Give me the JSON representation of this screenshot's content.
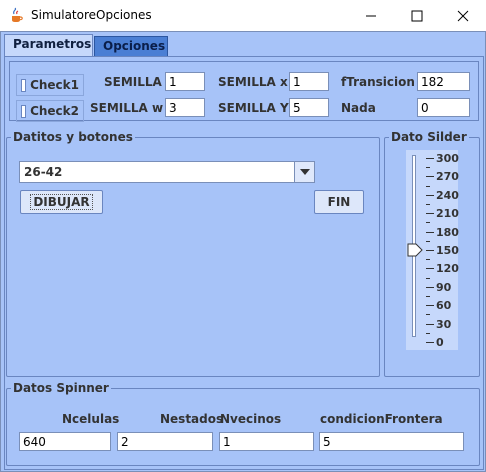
{
  "window": {
    "title": "SimulatoreOpciones"
  },
  "tabs": [
    {
      "label": "Parametros",
      "active": true
    },
    {
      "label": "Opciones",
      "active": false
    }
  ],
  "parameters": {
    "check1_label": "Check1",
    "check2_label": "Check2",
    "semilla_label": "SEMILLA",
    "semilla_value": "1",
    "semilla_x_label": "SEMILLA x",
    "semilla_x_value": "1",
    "ftransicion_label": "fTransicion",
    "ftransicion_value": "182",
    "semilla_w_label": "SEMILLA w",
    "semilla_w_value": "3",
    "semilla_y_label": "SEMILLA Y",
    "semilla_y_value": "5",
    "nada_label": "Nada",
    "nada_value": "0"
  },
  "datitos": {
    "title": "Datitos y botones",
    "combo_value": "26-42",
    "dibujar_label": "DIBUJAR",
    "fin_label": "FIN"
  },
  "slider": {
    "title": "Dato Silder",
    "value": 150,
    "min": 0,
    "max": 300,
    "ticks": [
      "300",
      "270",
      "240",
      "210",
      "180",
      "150",
      "120",
      "90",
      "60",
      "30",
      "0"
    ]
  },
  "spinner": {
    "title": "Datos Spinner",
    "ncelulas_label": "Ncelulas",
    "ncelulas_value": "640",
    "nestados_label": "Nestados",
    "nestados_value": "2",
    "nvecinos_label": "Nvecinos",
    "nvecinos_value": "1",
    "condicion_label": "condicionFrontera",
    "condicion_value": "5"
  },
  "colors": {
    "background": "#a7c3f8",
    "tab_inactive": "#4b7fd4",
    "border": "#6a86c0"
  },
  "icons": {
    "app": "java-cup-icon",
    "minimize": "minimize-icon",
    "maximize": "maximize-icon",
    "close": "close-icon",
    "dropdown": "triangle-down-icon"
  }
}
